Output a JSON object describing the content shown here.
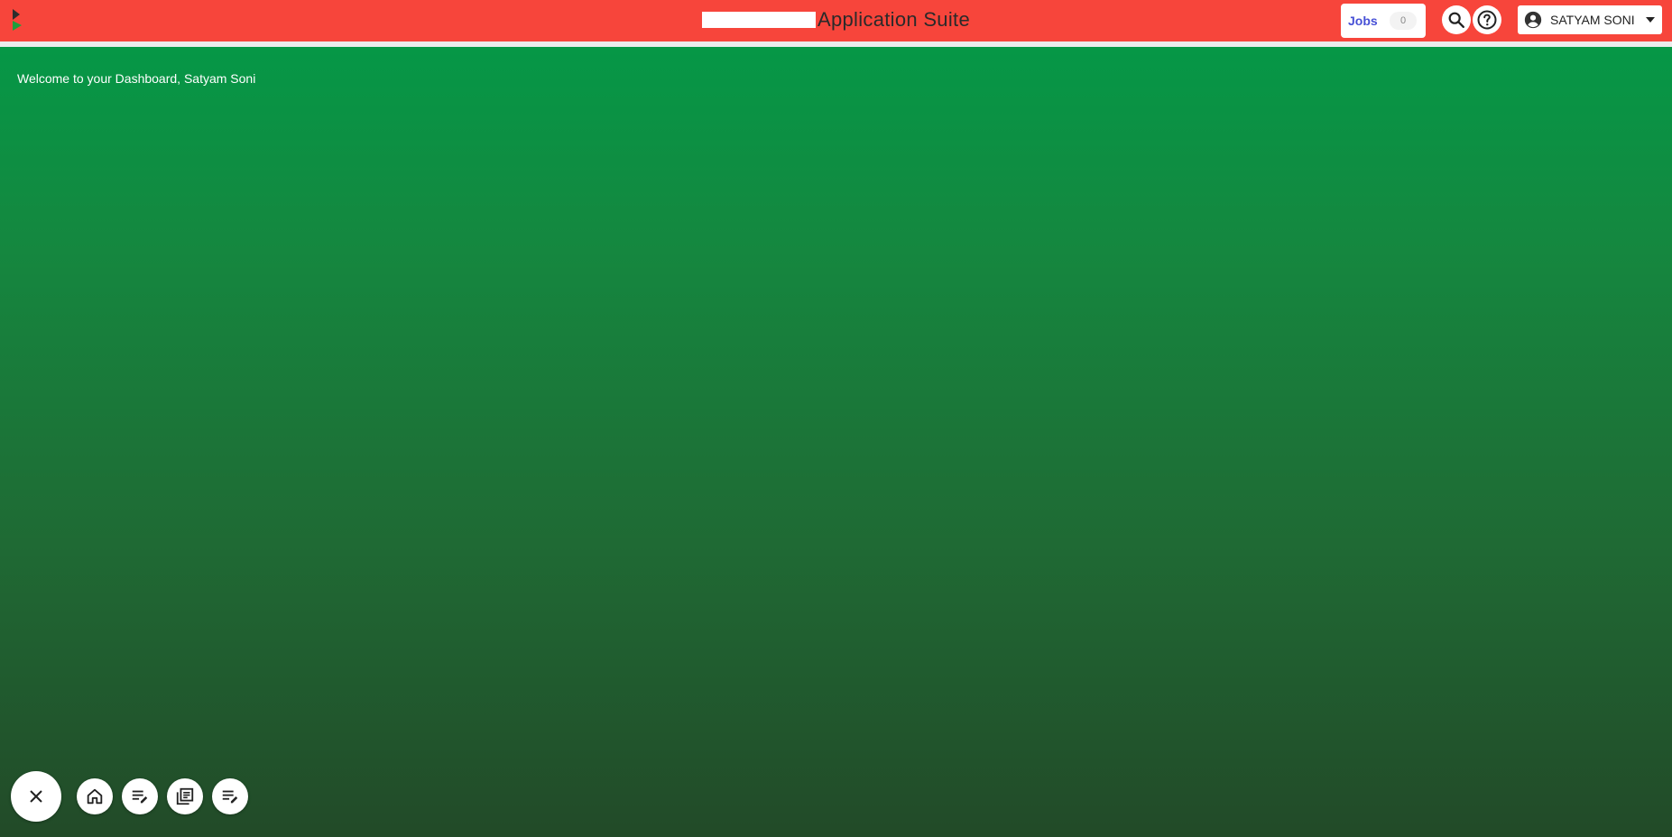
{
  "header": {
    "app_title": "Application Suite",
    "jobs_label": "Jobs",
    "jobs_count": "0",
    "user_name": "SATYAM SONI"
  },
  "main": {
    "welcome_text": "Welcome to your Dashboard, Satyam Soni"
  },
  "icons": {
    "logo": "app-logo",
    "search": "search-icon",
    "help": "help-icon",
    "account": "account-circle-icon",
    "caret": "caret-down-icon",
    "close": "close-icon",
    "home": "home-icon",
    "edit_list": "edit-list-icon",
    "library": "library-books-icon"
  },
  "colors": {
    "header_bg": "#f7453b",
    "jobs_text": "#4750d6",
    "gradient_top": "#029b48",
    "gradient_bottom": "#224a28"
  }
}
